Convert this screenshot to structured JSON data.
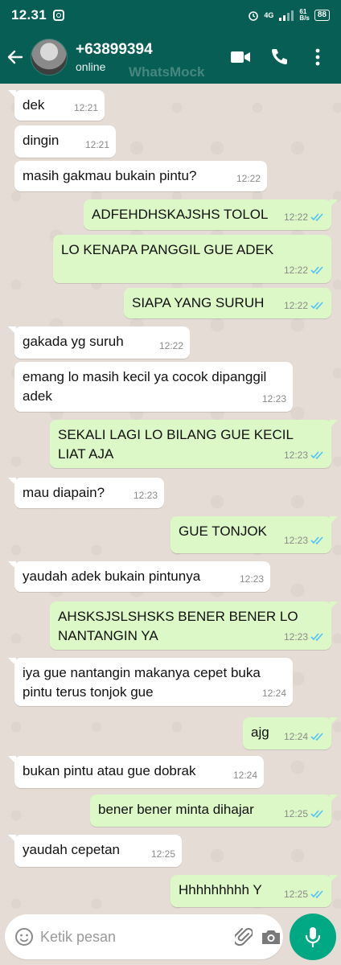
{
  "status_bar": {
    "time": "12.31",
    "network": "4G",
    "speed": "61\nB/s",
    "battery": "88"
  },
  "header": {
    "contact_name": "+63899394",
    "contact_status": "online",
    "watermark": "WhatsMock"
  },
  "messages": [
    {
      "dir": "in",
      "text": "dek",
      "time": "12:21"
    },
    {
      "dir": "in",
      "text": "dingin",
      "time": "12:21"
    },
    {
      "dir": "in",
      "text": "masih gakmau bukain pintu?",
      "time": "12:22"
    },
    {
      "dir": "out",
      "text": "ADFEHDHSKAJSHS TOLOL",
      "time": "12:22"
    },
    {
      "dir": "out",
      "text": "LO KENAPA PANGGIL GUE ADEK",
      "time": "12:22"
    },
    {
      "dir": "out",
      "text": "SIAPA YANG SURUH",
      "time": "12:22"
    },
    {
      "dir": "in",
      "text": "gakada yg suruh",
      "time": "12:22"
    },
    {
      "dir": "in",
      "text": "emang lo masih kecil ya cocok dipanggil adek",
      "time": "12:23"
    },
    {
      "dir": "out",
      "text": "SEKALI LAGI LO BILANG GUE KECIL LIAT AJA",
      "time": "12:23"
    },
    {
      "dir": "in",
      "text": "mau diapain?",
      "time": "12:23"
    },
    {
      "dir": "out",
      "text": "GUE TONJOK",
      "time": "12:23"
    },
    {
      "dir": "in",
      "text": "yaudah adek bukain pintunya",
      "time": "12:23"
    },
    {
      "dir": "out",
      "text": "AHSKSJSLSHSKS BENER BENER LO NANTANGIN YA",
      "time": "12:23"
    },
    {
      "dir": "in",
      "text": "iya gue nantangin makanya cepet buka pintu terus tonjok gue",
      "time": "12:24"
    },
    {
      "dir": "out",
      "text": "ajg",
      "time": "12:24"
    },
    {
      "dir": "in",
      "text": "bukan pintu atau gue dobrak",
      "time": "12:24"
    },
    {
      "dir": "out",
      "text": "bener bener minta dihajar",
      "time": "12:25"
    },
    {
      "dir": "in",
      "text": "yaudah cepetan",
      "time": "12:25"
    },
    {
      "dir": "out",
      "text": "Hhhhhhhhh Y",
      "time": "12:25"
    }
  ],
  "input": {
    "placeholder": "Ketik pesan",
    "value": ""
  },
  "colors": {
    "header": "#075e54",
    "outgoing": "#dcf8c6",
    "incoming": "#ffffff",
    "read_tick": "#4fc3f7",
    "fab": "#00a884"
  }
}
